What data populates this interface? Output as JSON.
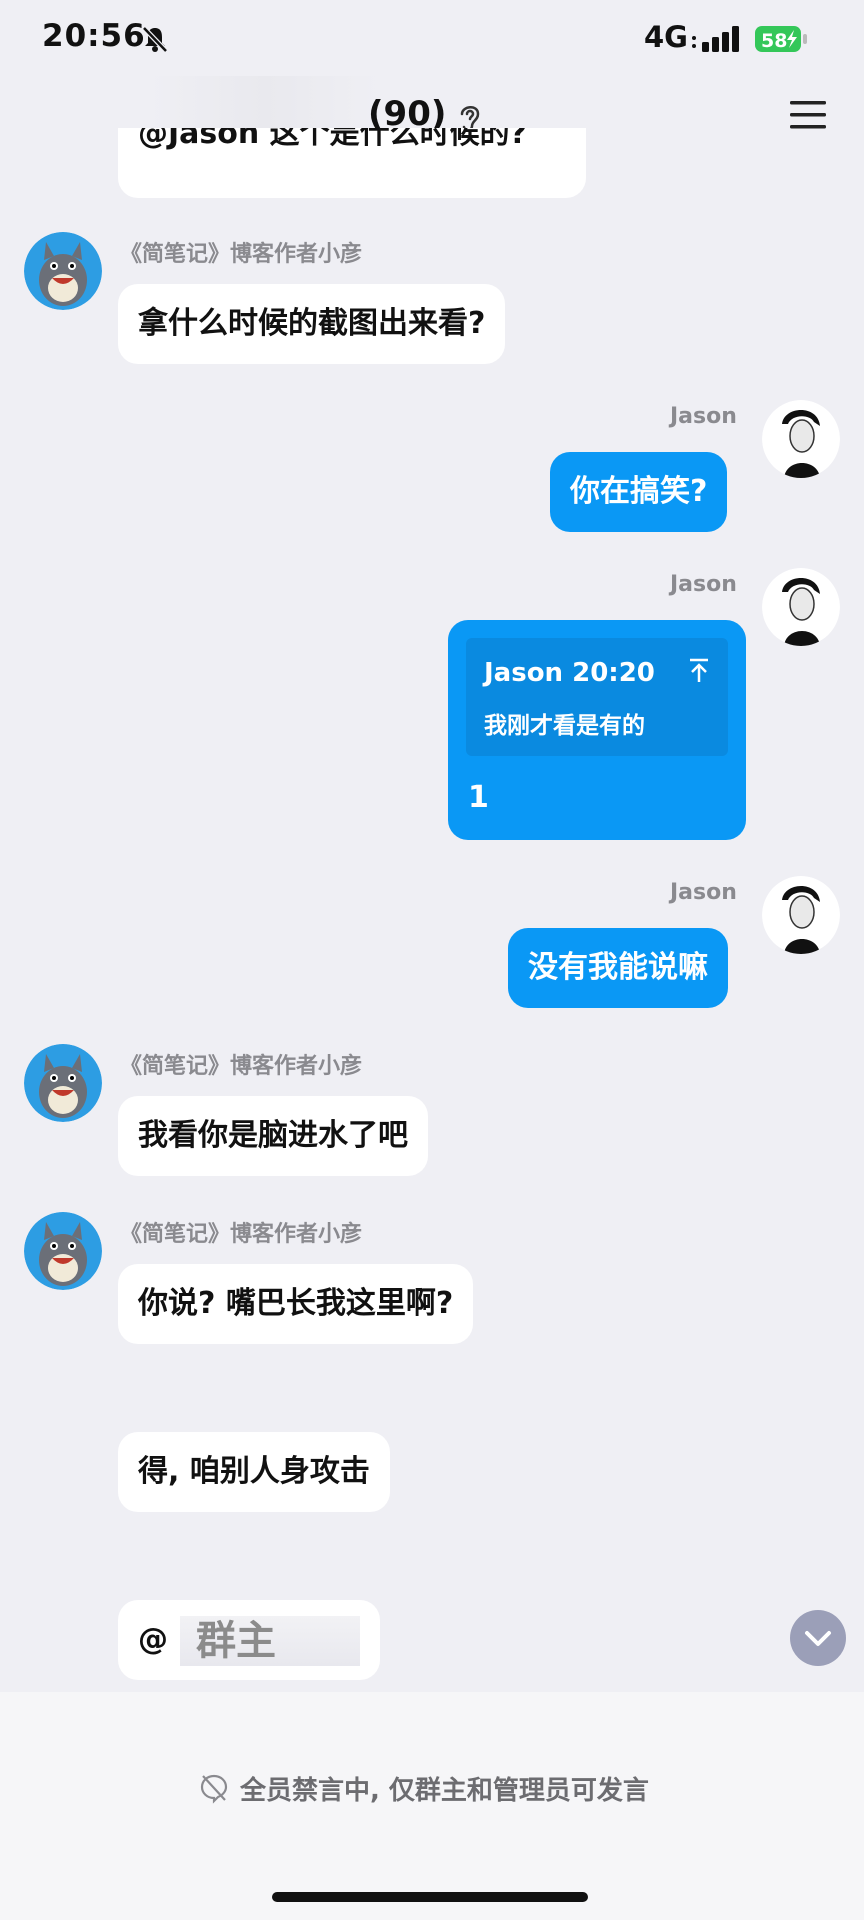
{
  "status": {
    "time": "20:56",
    "network": "4G",
    "battery": "58"
  },
  "header": {
    "title": "(90)"
  },
  "messages": {
    "partial_text": "@Jason 这个是什么时候的?",
    "m1": {
      "sender": "《简笔记》博客作者小彦",
      "text": "拿什么时候的截图出来看?"
    },
    "m2": {
      "sender": "Jason",
      "text": "你在搞笑?"
    },
    "m3": {
      "sender": "Jason",
      "quote_author": "Jason 20:20",
      "quote_text": "我刚才看是有的",
      "reply": "1"
    },
    "m4": {
      "sender": "Jason",
      "text": "没有我能说嘛"
    },
    "m5": {
      "sender": "《简笔记》博客作者小彦",
      "text": "我看你是脑进水了吧"
    },
    "m6": {
      "sender": "《简笔记》博客作者小彦",
      "text": "你说? 嘴巴长我这里啊?"
    },
    "m7": {
      "text": "得, 咱别人身攻击"
    },
    "m8": {
      "at": "@",
      "mention": "群主"
    }
  },
  "footer": {
    "mute_notice": "全员禁言中, 仅群主和管理员可发言"
  },
  "colors": {
    "bubble_me": "#0a98f5",
    "background": "#efeff4"
  }
}
